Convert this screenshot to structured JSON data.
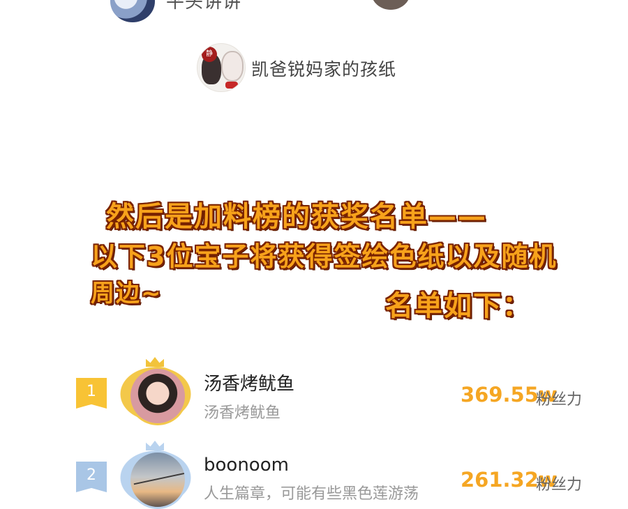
{
  "top_row": {
    "name": "平头讲讲"
  },
  "featured_user": {
    "name": "凯爸锐妈家的孩纸",
    "avatar_tag": "静"
  },
  "announcement": {
    "line1": "然后是加料榜的获奖名单——",
    "line2": "以下3位宝子将获得签绘色纸以及随机",
    "line3": "周边~",
    "line4": "名单如下："
  },
  "ranking": [
    {
      "rank": "1",
      "name": "汤香烤鱿鱼",
      "subtitle": "汤香烤鱿鱼",
      "fans_value": "369.55w",
      "fans_label": "粉丝力",
      "tier_color": "#f8c335"
    },
    {
      "rank": "2",
      "name": "boonoom",
      "subtitle": "人生篇章，可能有些黑色莲游荡",
      "fans_value": "261.32w",
      "fans_label": "粉丝力",
      "tier_color": "#a9c6e6"
    }
  ],
  "colors": {
    "accent": "#f5a623",
    "headline_fill": "#f7a21b",
    "headline_outline": "#7a2300"
  }
}
